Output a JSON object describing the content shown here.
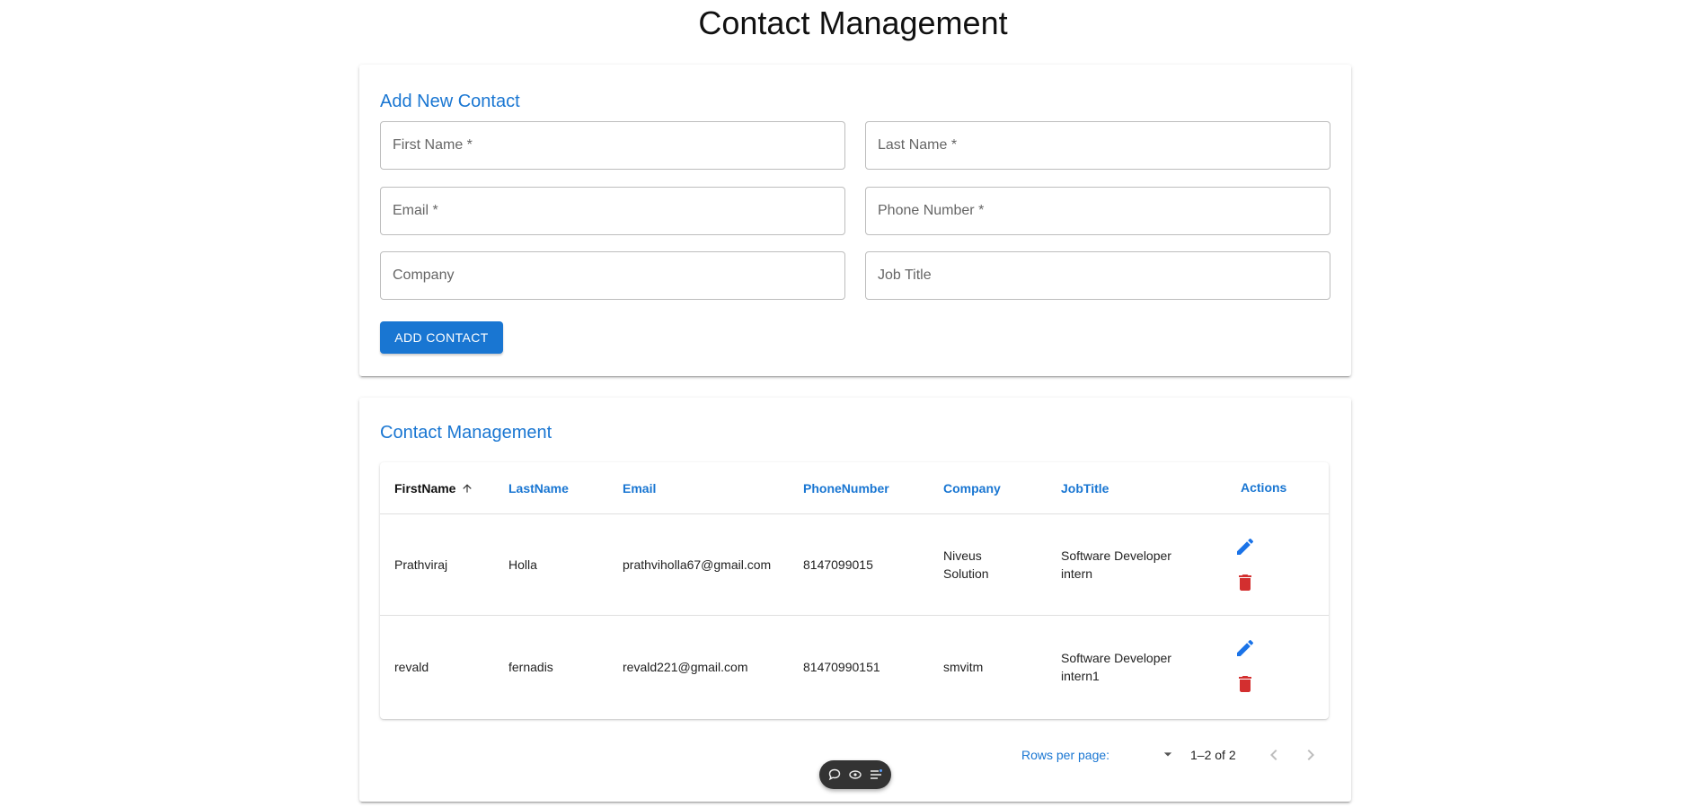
{
  "page": {
    "title": "Contact Management"
  },
  "form": {
    "title": "Add New Contact",
    "first_name": {
      "placeholder": "First Name *",
      "value": ""
    },
    "last_name": {
      "placeholder": "Last Name *",
      "value": ""
    },
    "email": {
      "placeholder": "Email *",
      "value": ""
    },
    "phone": {
      "placeholder": "Phone Number *",
      "value": ""
    },
    "company": {
      "placeholder": "Company",
      "value": ""
    },
    "job_title": {
      "placeholder": "Job Title",
      "value": ""
    },
    "submit_label": "ADD CONTACT"
  },
  "table": {
    "title": "Contact Management",
    "columns": [
      "FirstName",
      "LastName",
      "Email",
      "PhoneNumber",
      "Company",
      "JobTitle",
      "Actions"
    ],
    "sort": {
      "column": "FirstName",
      "direction": "ascending"
    },
    "rows": [
      {
        "first": "Prathviraj",
        "last": "Holla",
        "email": "prathviholla67@gmail.com",
        "phone": "8147099015",
        "company": "Niveus Solution",
        "job": "Software Developer intern"
      },
      {
        "first": "revald",
        "last": "fernadis",
        "email": "revald221@gmail.com",
        "phone": "81470990151",
        "company": "smvitm",
        "job": "Software Developer intern1"
      }
    ],
    "actions": {
      "edit_icon": "pencil-icon",
      "delete_icon": "trash-icon"
    },
    "pagination": {
      "rows_per_page_label": "Rows per page:",
      "rows_per_page_value": "",
      "range": "1–2 of 2"
    }
  },
  "toolbar": {
    "icons": [
      "chat-bubble-icon",
      "eye-icon",
      "list-icon"
    ]
  },
  "colors": {
    "primary": "#1976d2",
    "delete": "#d32f2f",
    "edit": "#1a73e8"
  }
}
